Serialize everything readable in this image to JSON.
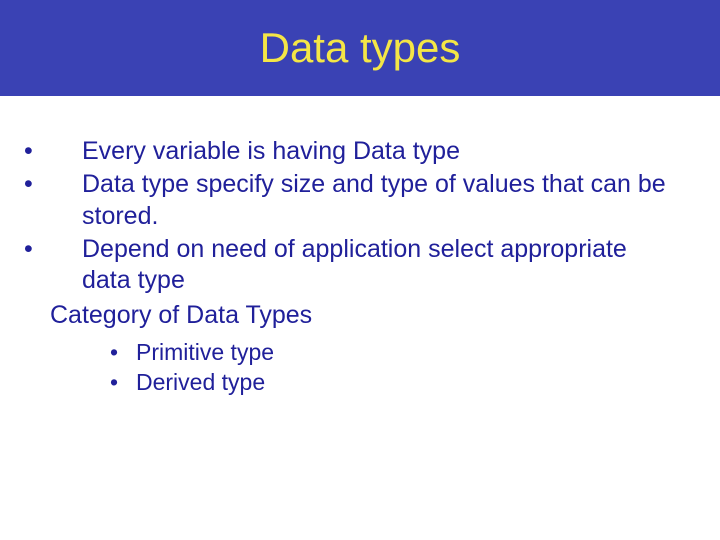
{
  "slide": {
    "title": "Data types",
    "bullets": [
      "Every variable is having Data type",
      "Data type specify size and type of values that can be stored.",
      "Depend on need of application select appropriate data type"
    ],
    "category_heading": "Category of Data Types",
    "sub_bullets": [
      "Primitive type",
      "Derived type"
    ]
  }
}
